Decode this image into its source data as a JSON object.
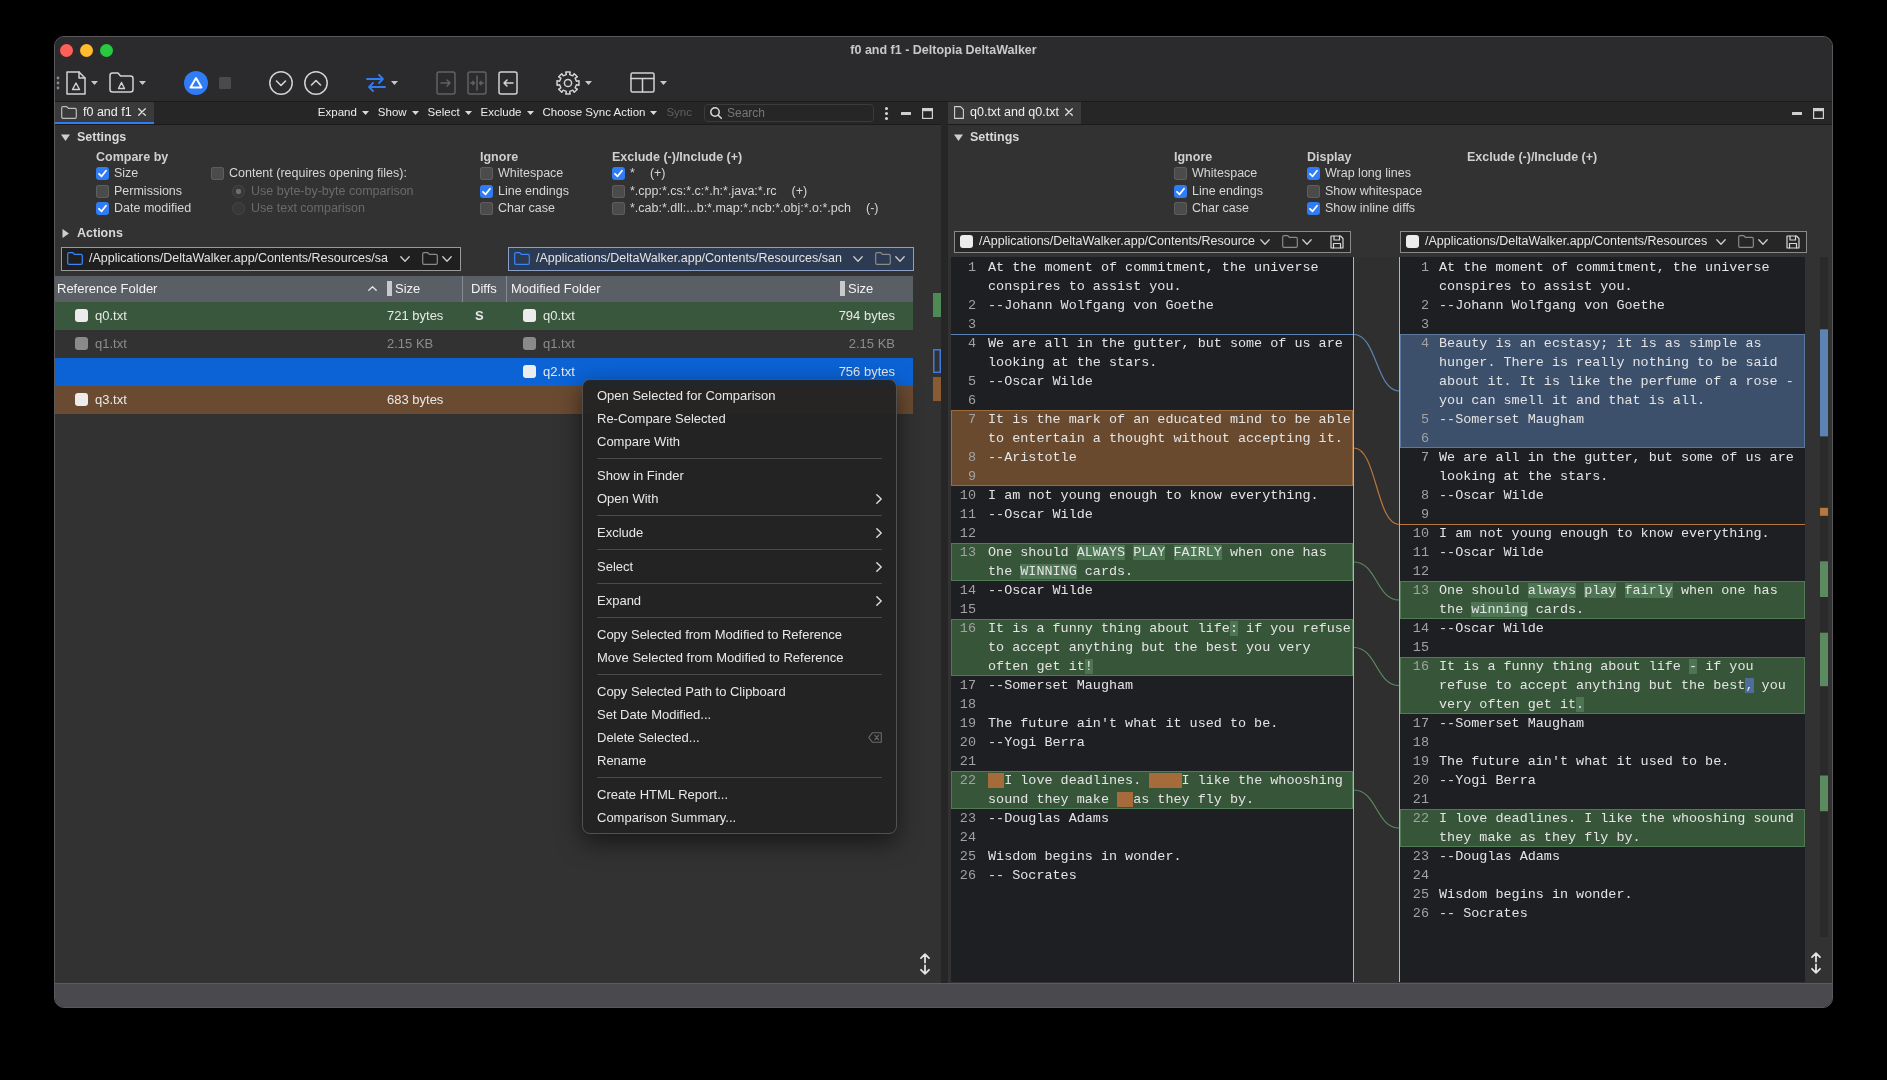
{
  "window": {
    "title": "f0 and f1 - Deltopia DeltaWalker"
  },
  "toolbar": [
    {
      "items": [
        {
          "kind": "file",
          "disabled": false,
          "dropdown": true
        },
        {
          "kind": "folder",
          "disabled": false,
          "dropdown": true
        }
      ]
    },
    {
      "items": [
        {
          "kind": "run",
          "disabled": false,
          "dropdown": false
        },
        {
          "kind": "stop",
          "disabled": true,
          "dropdown": false
        }
      ]
    },
    {
      "items": [
        {
          "kind": "next",
          "disabled": false,
          "dropdown": false
        },
        {
          "kind": "previous",
          "disabled": false,
          "dropdown": false
        }
      ]
    },
    {
      "items": [
        {
          "kind": "sync",
          "disabled": false,
          "dropdown": true
        }
      ]
    },
    {
      "items": [
        {
          "kind": "push",
          "disabled": true,
          "dropdown": false
        },
        {
          "kind": "merge",
          "disabled": true,
          "dropdown": false
        },
        {
          "kind": "pull",
          "disabled": false,
          "dropdown": false
        }
      ]
    },
    {
      "items": [
        {
          "kind": "settings",
          "disabled": false,
          "dropdown": true
        }
      ]
    },
    {
      "items": [
        {
          "kind": "layout",
          "disabled": false,
          "dropdown": true
        }
      ]
    }
  ],
  "folder_compare": {
    "tab": {
      "label": "f0 and f1",
      "selected": true
    },
    "menus": [
      {
        "label": "Expand",
        "disabled": false,
        "dropdown": true
      },
      {
        "label": "Show",
        "disabled": false,
        "dropdown": true
      },
      {
        "label": "Select",
        "disabled": false,
        "dropdown": true
      },
      {
        "label": "Exclude",
        "disabled": false,
        "dropdown": true
      },
      {
        "label": "Choose Sync Action",
        "disabled": false,
        "dropdown": true
      },
      {
        "label": "Sync",
        "disabled": true,
        "dropdown": false
      }
    ],
    "search": {
      "placeholder": "Search"
    },
    "settings": {
      "title": "Settings",
      "expanded": true,
      "compare_by": {
        "title": "Compare by",
        "options": [
          {
            "label": "Size",
            "checked": true
          },
          {
            "label": "Permissions",
            "checked": false
          },
          {
            "label": "Date modified",
            "checked": true
          }
        ],
        "content": {
          "label": "Content (requires opening files):",
          "checked": false,
          "modes": [
            {
              "label": "Use byte-by-byte comparison",
              "selected": true,
              "disabled": true
            },
            {
              "label": "Use text comparison",
              "selected": false,
              "disabled": true
            }
          ]
        }
      },
      "ignore": {
        "title": "Ignore",
        "options": [
          {
            "label": "Whitespace",
            "checked": false
          },
          {
            "label": "Line endings",
            "checked": true
          },
          {
            "label": "Char case",
            "checked": false
          }
        ]
      },
      "filters": {
        "title": "Exclude (-)/Include (+)",
        "items": [
          {
            "pattern": "*",
            "mode": "(+)",
            "checked": true
          },
          {
            "pattern": "*.cpp:*.cs:*.c:*.h:*.java:*.rc",
            "mode": "(+)",
            "checked": false
          },
          {
            "pattern": "*.cab:*.dll:...b:*.map:*.ncb:*.obj:*.o:*.pch",
            "mode": "(-)",
            "checked": false
          }
        ]
      }
    },
    "actions": {
      "title": "Actions",
      "expanded": false
    },
    "paths": [
      {
        "path": "/Applications/DeltaWalker.app/Contents/Resources/sa",
        "focused": false
      },
      {
        "path": "/Applications/DeltaWalker.app/Contents/Resources/san",
        "focused": true
      }
    ],
    "table": {
      "columns": [
        {
          "label": "Reference Folder",
          "sorted": true
        },
        {
          "label": "Size",
          "sorted": false
        },
        {
          "label": "Diffs",
          "sorted": false
        },
        {
          "label": "Modified Folder",
          "sorted": false
        },
        {
          "label": "Size",
          "sorted": false
        }
      ],
      "rows": [
        {
          "kind": "changed",
          "selected": false,
          "reference": {
            "name": "q0.txt",
            "size": "721 bytes"
          },
          "diffs": "S",
          "modified": {
            "name": "q0.txt",
            "size": "794 bytes"
          }
        },
        {
          "kind": "same",
          "selected": false,
          "reference": {
            "name": "q1.txt",
            "size": "2.15 KB"
          },
          "modified": {
            "name": "q1.txt",
            "size": "2.15 KB"
          }
        },
        {
          "kind": "added",
          "selected": true,
          "modified": {
            "name": "q2.txt",
            "size": "756 bytes"
          }
        },
        {
          "kind": "removed",
          "selected": false,
          "reference": {
            "name": "q3.txt",
            "size": "683 bytes"
          }
        }
      ]
    },
    "context_menu": {
      "groups": [
        [
          {
            "label": "Open Selected for Comparison",
            "submenu": false
          },
          {
            "label": "Re-Compare Selected",
            "submenu": false
          },
          {
            "label": "Compare With",
            "submenu": false
          }
        ],
        [
          {
            "label": "Show in Finder",
            "submenu": false
          },
          {
            "label": "Open With",
            "submenu": true
          }
        ],
        [
          {
            "label": "Exclude",
            "submenu": true
          }
        ],
        [
          {
            "label": "Select",
            "submenu": true
          }
        ],
        [
          {
            "label": "Expand",
            "submenu": true
          }
        ],
        [
          {
            "label": "Copy Selected from Modified to Reference",
            "submenu": false
          },
          {
            "label": "Move Selected from Modified to Reference",
            "submenu": false
          }
        ],
        [
          {
            "label": "Copy Selected Path to Clipboard",
            "submenu": false
          },
          {
            "label": "Set Date Modified...",
            "submenu": false
          },
          {
            "label": "Delete Selected...",
            "submenu": false,
            "shortcut_icon": true
          },
          {
            "label": "Rename",
            "submenu": false
          }
        ],
        [
          {
            "label": "Create HTML Report...",
            "submenu": false
          },
          {
            "label": "Comparison Summary...",
            "submenu": false
          }
        ]
      ]
    }
  },
  "file_compare": {
    "tab": {
      "label": "q0.txt and q0.txt",
      "selected": false
    },
    "settings": {
      "title": "Settings",
      "expanded": true,
      "ignore": {
        "title": "Ignore",
        "options": [
          {
            "label": "Whitespace",
            "checked": false
          },
          {
            "label": "Line endings",
            "checked": true
          },
          {
            "label": "Char case",
            "checked": false
          }
        ]
      },
      "display": {
        "title": "Display",
        "options": [
          {
            "label": "Wrap long lines",
            "checked": true
          },
          {
            "label": "Show whitespace",
            "checked": false
          },
          {
            "label": "Show inline diffs",
            "checked": true
          }
        ]
      },
      "filters": {
        "title": "Exclude (-)/Include (+)"
      }
    },
    "paths": [
      {
        "path": "/Applications/DeltaWalker.app/Contents/Resource"
      },
      {
        "path": "/Applications/DeltaWalker.app/Contents/Resources"
      }
    ],
    "left_lines": [
      {
        "number": "1",
        "kind": "same",
        "text": "At the moment of commitment, the universe conspires to assist you."
      },
      {
        "number": "2",
        "kind": "same",
        "text": "--Johann Wolfgang von Goethe"
      },
      {
        "number": "3",
        "kind": "same"
      },
      {
        "number": "4",
        "kind": "same",
        "text": "We are all in the gutter, but some of us are looking at the stars.",
        "gap_above": true
      },
      {
        "number": "5",
        "kind": "same",
        "text": "--Oscar Wilde"
      },
      {
        "number": "6",
        "kind": "same"
      },
      {
        "number": "7",
        "kind": "removed",
        "text": "It is the mark of an educated mind to be able to entertain a thought without accepting it."
      },
      {
        "number": "8",
        "kind": "removed",
        "text": "--Aristotle"
      },
      {
        "number": "9",
        "kind": "removed"
      },
      {
        "number": "10",
        "kind": "same",
        "text": "I am not young enough to know everything."
      },
      {
        "number": "11",
        "kind": "same",
        "text": "--Oscar Wilde"
      },
      {
        "number": "12",
        "kind": "same"
      },
      {
        "number": "13",
        "kind": "changed",
        "segments": [
          {
            "text": "One should ",
            "kind": "plain"
          },
          {
            "text": "ALWAYS",
            "kind": "changed"
          },
          {
            "text": " PLAY",
            "kind": "changed"
          },
          {
            "text": " FAIRLY",
            "kind": "changed"
          },
          {
            "text": " when one has the ",
            "kind": "plain"
          },
          {
            "text": "WINNING",
            "kind": "changed"
          },
          {
            "text": " cards.",
            "kind": "plain"
          }
        ]
      },
      {
        "number": "14",
        "kind": "same",
        "text": "--Oscar Wilde"
      },
      {
        "number": "15",
        "kind": "same"
      },
      {
        "number": "16",
        "kind": "changed",
        "segments": [
          {
            "text": "It is a funny thing about life",
            "kind": "plain"
          },
          {
            "text": ":",
            "kind": "changed"
          },
          {
            "text": " if you refuse to accept anything but the best you very often get it",
            "kind": "plain"
          },
          {
            "text": "!",
            "kind": "changed"
          }
        ]
      },
      {
        "number": "17",
        "kind": "same",
        "text": "--Somerset Maugham"
      },
      {
        "number": "18",
        "kind": "same"
      },
      {
        "number": "19",
        "kind": "same",
        "text": "The future ain't what it used to be."
      },
      {
        "number": "20",
        "kind": "same",
        "text": "--Yogi Berra"
      },
      {
        "number": "21",
        "kind": "same"
      },
      {
        "number": "22",
        "kind": "changed",
        "segments": [
          {
            "text": "  I love deadlines. ",
            "kind": "padded"
          },
          {
            "text": "    I like the whooshing sound they make ",
            "kind": "padded"
          },
          {
            "text": "  as they fly by.",
            "kind": "padded"
          }
        ]
      },
      {
        "number": "23",
        "kind": "same",
        "text": "--Douglas Adams"
      },
      {
        "number": "24",
        "kind": "same"
      },
      {
        "number": "25",
        "kind": "same",
        "text": "Wisdom begins in wonder."
      },
      {
        "number": "26",
        "kind": "same",
        "text": "-- Socrates"
      }
    ],
    "right_lines": [
      {
        "number": "1",
        "kind": "same",
        "text": "At the moment of commitment, the universe conspires to assist you."
      },
      {
        "number": "2",
        "kind": "same",
        "text": "--Johann Wolfgang von Goethe"
      },
      {
        "number": "3",
        "kind": "same"
      },
      {
        "number": "4",
        "kind": "added",
        "text": "Beauty is an ecstasy; it is as simple as hunger. There is really nothing to be said about it. It is like the perfume of a rose - you can smell it and that is all."
      },
      {
        "number": "5",
        "kind": "added",
        "text": "--Somerset Maugham"
      },
      {
        "number": "6",
        "kind": "added"
      },
      {
        "number": "7",
        "kind": "same",
        "text": "We are all in the gutter, but some of us are looking at the stars."
      },
      {
        "number": "8",
        "kind": "same",
        "text": "--Oscar Wilde"
      },
      {
        "number": "9",
        "kind": "same"
      },
      {
        "number": "10",
        "kind": "same",
        "text": "I am not young enough to know everything.",
        "gap_above": true
      },
      {
        "number": "11",
        "kind": "same",
        "text": "--Oscar Wilde"
      },
      {
        "number": "12",
        "kind": "same"
      },
      {
        "number": "13",
        "kind": "changed",
        "segments": [
          {
            "text": "One should ",
            "kind": "plain"
          },
          {
            "text": "always",
            "kind": "changed"
          },
          {
            "text": " play",
            "kind": "changed"
          },
          {
            "text": " fairly",
            "kind": "changed"
          },
          {
            "text": " when one has the ",
            "kind": "plain"
          },
          {
            "text": "winning",
            "kind": "changed"
          },
          {
            "text": " cards.",
            "kind": "plain"
          }
        ]
      },
      {
        "number": "14",
        "kind": "same",
        "text": "--Oscar Wilde"
      },
      {
        "number": "15",
        "kind": "same"
      },
      {
        "number": "16",
        "kind": "changed",
        "segments": [
          {
            "text": "It is a funny thing about life",
            "kind": "plain"
          },
          {
            "text": " -",
            "kind": "changed"
          },
          {
            "text": " if you refuse to accept anything but the best",
            "kind": "plain"
          },
          {
            "text": ",",
            "kind": "added"
          },
          {
            "text": " you very often get it",
            "kind": "plain"
          },
          {
            "text": ".",
            "kind": "changed"
          }
        ]
      },
      {
        "number": "17",
        "kind": "same",
        "text": "--Somerset Maugham"
      },
      {
        "number": "18",
        "kind": "same"
      },
      {
        "number": "19",
        "kind": "same",
        "text": "The future ain't what it used to be."
      },
      {
        "number": "20",
        "kind": "same",
        "text": "--Yogi Berra"
      },
      {
        "number": "21",
        "kind": "same"
      },
      {
        "number": "22",
        "kind": "changed",
        "text": "I love deadlines. I like the whooshing sound they make as they fly by."
      },
      {
        "number": "23",
        "kind": "same",
        "text": "--Douglas Adams"
      },
      {
        "number": "24",
        "kind": "same"
      },
      {
        "number": "25",
        "kind": "same",
        "text": "Wisdom begins in wonder."
      },
      {
        "number": "26",
        "kind": "same",
        "text": "-- Socrates"
      }
    ]
  }
}
